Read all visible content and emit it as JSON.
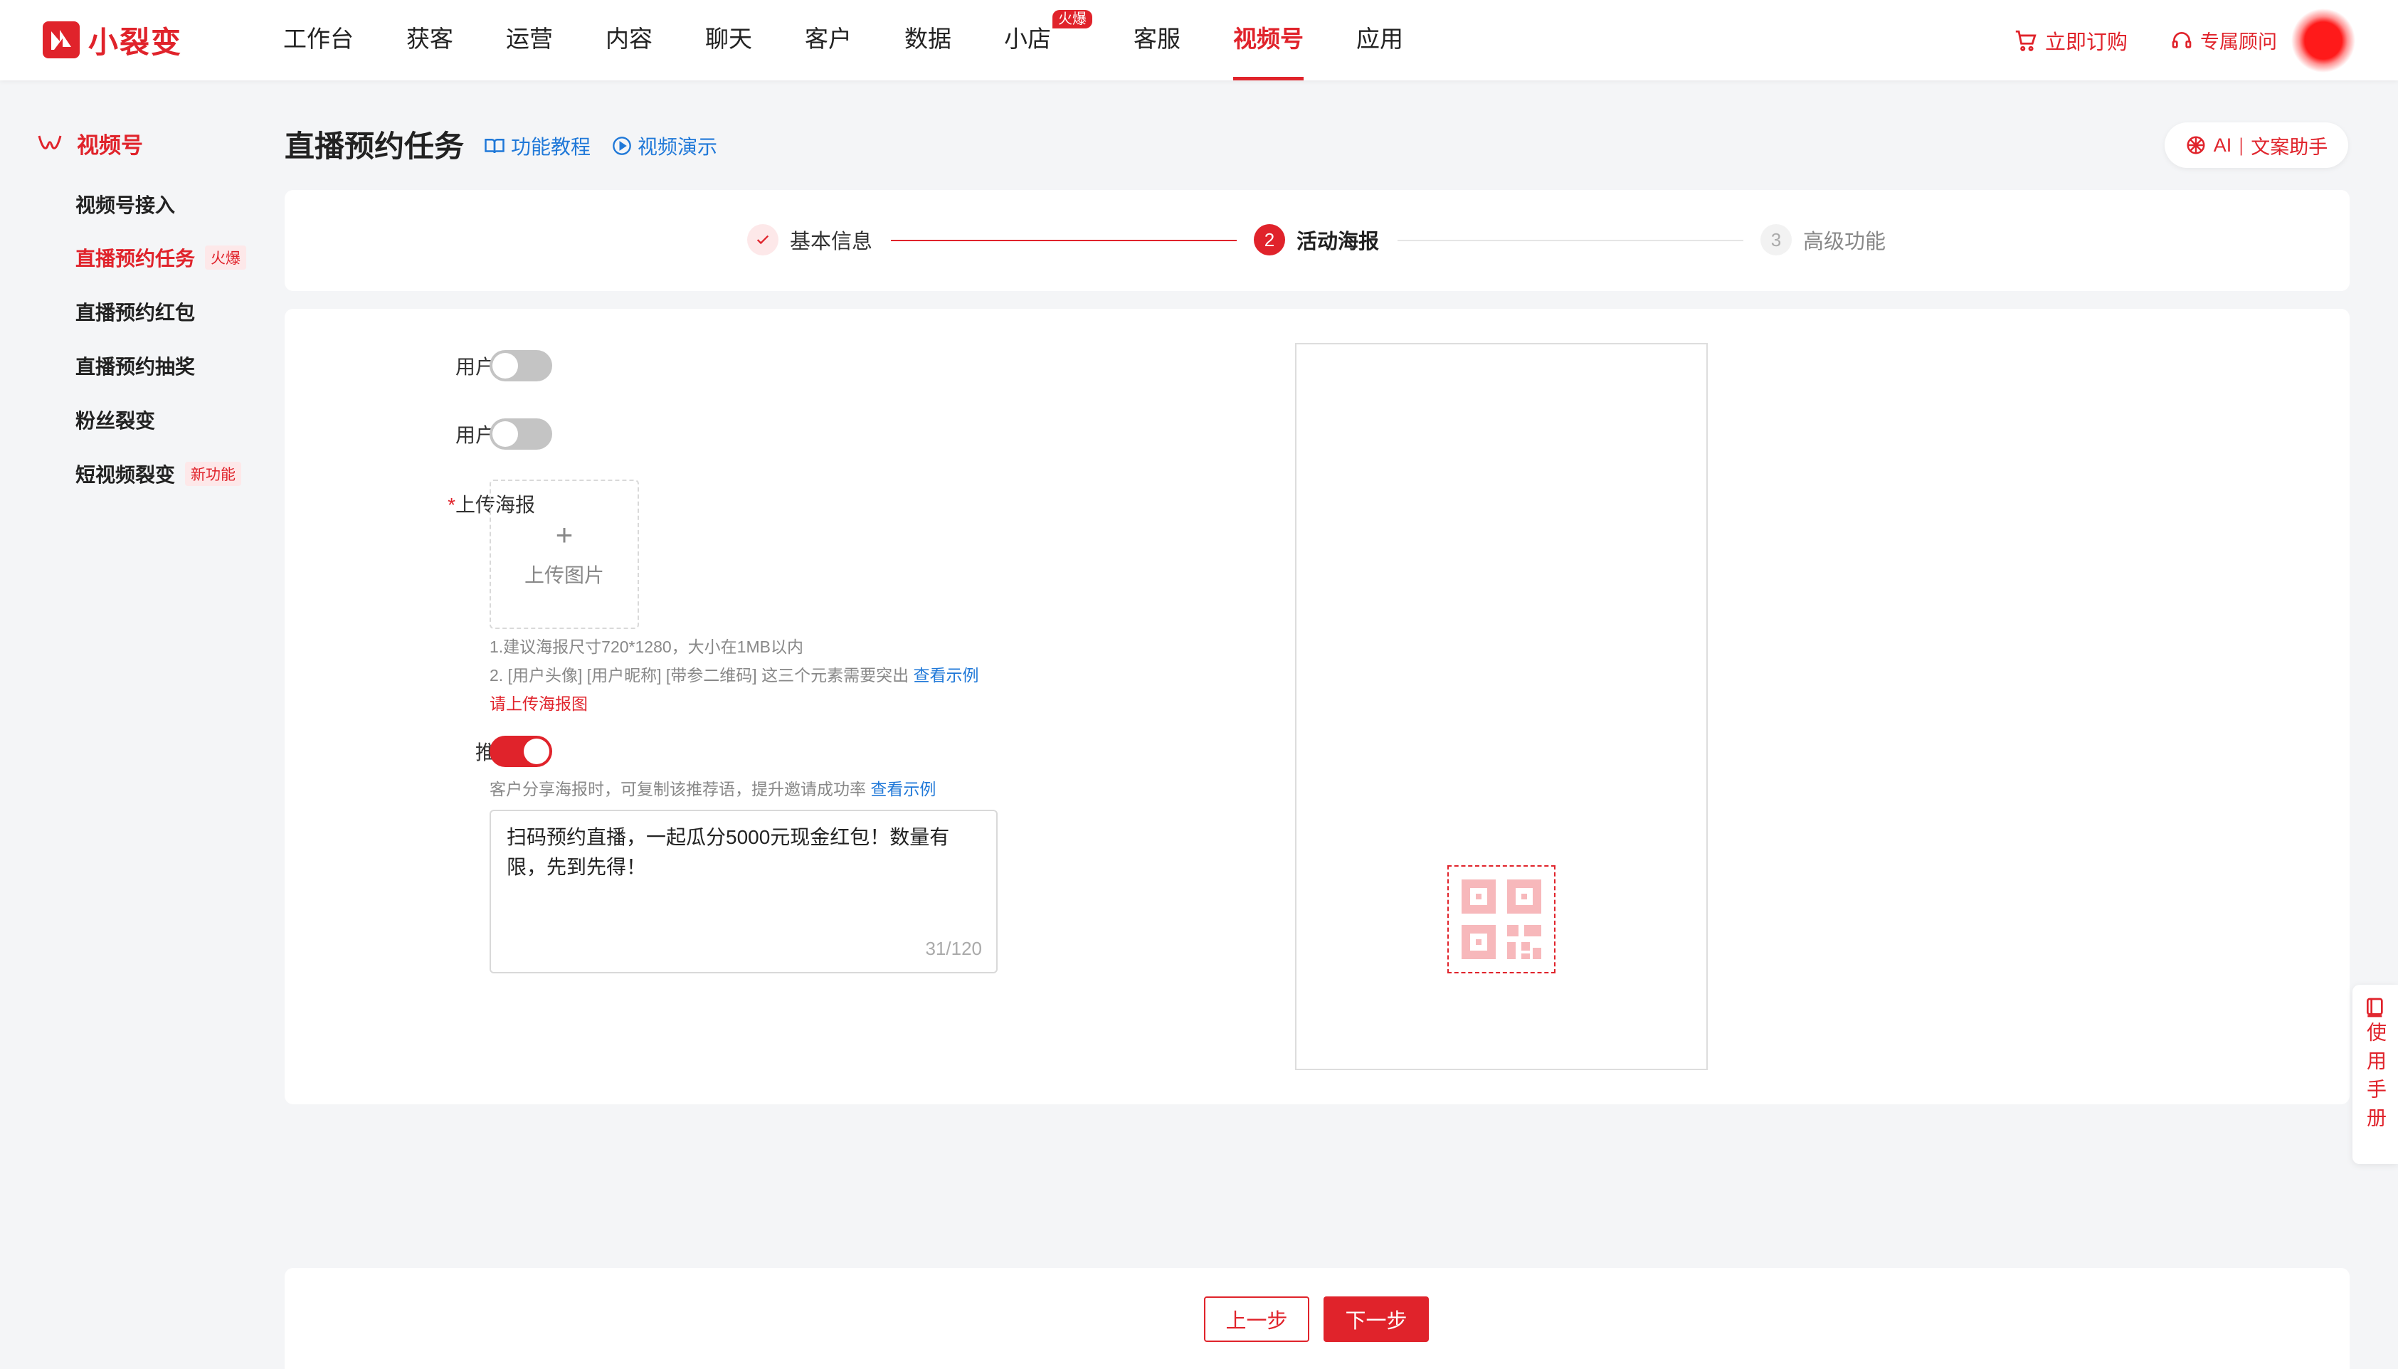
{
  "brand": {
    "name": "小裂变",
    "accent": "#e0232b",
    "link_color": "#1f78d8"
  },
  "nav": {
    "items": [
      {
        "label": "工作台"
      },
      {
        "label": "获客"
      },
      {
        "label": "运营"
      },
      {
        "label": "内容"
      },
      {
        "label": "聊天"
      },
      {
        "label": "客户"
      },
      {
        "label": "数据"
      },
      {
        "label": "小店",
        "badge": "火爆"
      },
      {
        "label": "客服"
      },
      {
        "label": "视频号",
        "active": true
      },
      {
        "label": "应用"
      }
    ],
    "buy_label": "立即订购",
    "consult_label": "专属顾问"
  },
  "sidebar": {
    "title": "视频号",
    "items": [
      {
        "label": "视频号接入"
      },
      {
        "label": "直播预约任务",
        "tag": "火爆",
        "active": true
      },
      {
        "label": "直播预约红包"
      },
      {
        "label": "直播预约抽奖"
      },
      {
        "label": "粉丝裂变"
      },
      {
        "label": "短视频裂变",
        "tag": "新功能"
      }
    ]
  },
  "header": {
    "title": "直播预约任务",
    "tutorial_link": "功能教程",
    "video_link": "视频演示",
    "ai_button": {
      "prefix": "AI",
      "label": "文案助手"
    }
  },
  "steps": [
    {
      "number": "✓",
      "label": "基本信息",
      "state": "done"
    },
    {
      "number": "2",
      "label": "活动海报",
      "state": "active"
    },
    {
      "number": "3",
      "label": "高级功能",
      "state": "pending"
    }
  ],
  "form": {
    "avatar_label": "用户头像",
    "avatar_enabled": false,
    "name_label": "用户名称",
    "name_enabled": false,
    "poster_label": "上传海报",
    "upload_plus": "+",
    "upload_text": "上传图片",
    "hint1": "1.建议海报尺寸720*1280，大小在1MB以内",
    "hint2": "2. [用户头像] [用户昵称] [带参二维码] 这三个元素需要突出",
    "hint2_link": "查看示例",
    "poster_error": "请上传海报图",
    "recommend_label": "推荐语",
    "recommend_enabled": true,
    "recommend_hint": "客户分享海报时，可复制该推荐语，提升邀请成功率",
    "recommend_link": "查看示例",
    "recommend_text": "扫码预约直播，一起瓜分5000元现金红包！数量有限，先到先得！",
    "recommend_counter": "31/120"
  },
  "footer": {
    "prev_label": "上一步",
    "next_label": "下一步"
  },
  "manual": {
    "label": "使用手册"
  }
}
